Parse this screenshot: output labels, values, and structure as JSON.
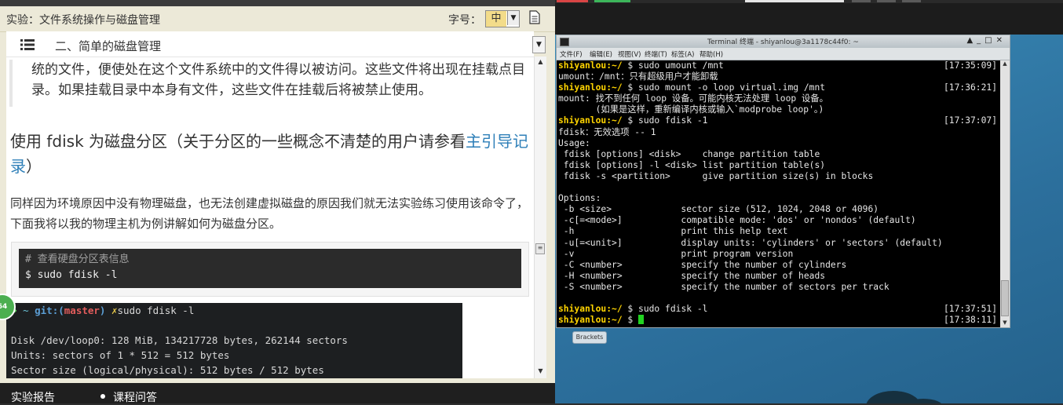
{
  "left_panel": {
    "experiment_title": "实验：文件系统操作与磁盘管理",
    "font_size_label": "字号：",
    "font_size_value": "中",
    "section_title": "二、简单的磁盘管理",
    "quote_text": "统的文件，便使处在这个文件系统中的文件得以被访问。这些文件将出现在挂载点目录。如果挂载目录中本身有文件，这些文件在挂载后将被禁止使用。",
    "heading_text": "使用 fdisk 为磁盘分区（关于分区的一些概念不清楚的用户请参看",
    "heading_link": "主引导记录",
    "heading_end": "）",
    "paragraph": "同样因为环境原因中没有物理磁盘，也无法创建虚拟磁盘的原因我们就无法实验练习使用该命令了，下面我将以我的物理主机为例讲解如何为磁盘分区。",
    "code_comment": "# 查看硬盘分区表信息",
    "code_command": "$ sudo fdisk -l",
    "screenshot": {
      "arrow": "➜",
      "tilde": "~",
      "git": "git:(",
      "branch": "master",
      "git_close": ")",
      "x_mark": "✗",
      "command": "sudo fdisk -l",
      "lines": [
        "Disk /dev/loop0: 128 MiB, 134217728 bytes, 262144 sectors",
        "Units: sectors of 1 * 512 = 512 bytes",
        "Sector size (logical/physical): 512 bytes / 512 bytes"
      ]
    },
    "badge": "64",
    "bottom_tabs": [
      "实验报告",
      "课程问答"
    ]
  },
  "terminal": {
    "title": "Terminal 终端 - shiyanlou@3a1178c44f0: ~",
    "menu": [
      "文件(F)",
      "编辑(E)",
      "视图(V)",
      "终端(T)",
      "标签(A)",
      "帮助(H)"
    ],
    "prompt": "shiyanlou:~/",
    "lines": [
      {
        "prompt": true,
        "text": " $ sudo umount /mnt",
        "time": "[17:35:09]"
      },
      {
        "prompt": false,
        "text": "umount：/mnt：只有超级用户才能卸载",
        "time": ""
      },
      {
        "prompt": true,
        "text": " $ sudo mount -o loop virtual.img /mnt",
        "time": "[17:36:21]"
      },
      {
        "prompt": false,
        "text": "mount: 找不到任何 loop 设备。可能内核无法处理 loop 设备。",
        "time": ""
      },
      {
        "prompt": false,
        "text": "       (如果是这样，重新编译内核或输入`modprobe loop'。)",
        "time": ""
      },
      {
        "prompt": true,
        "text": " $ sudo fdisk -1",
        "time": "[17:37:07]"
      },
      {
        "prompt": false,
        "text": "fdisk：无效选项 -- 1",
        "time": ""
      },
      {
        "prompt": false,
        "text": "Usage:",
        "time": ""
      },
      {
        "prompt": false,
        "text": " fdisk [options] <disk>    change partition table",
        "time": ""
      },
      {
        "prompt": false,
        "text": " fdisk [options] -l <disk> list partition table(s)",
        "time": ""
      },
      {
        "prompt": false,
        "text": " fdisk -s <partition>      give partition size(s) in blocks",
        "time": ""
      },
      {
        "prompt": false,
        "text": "",
        "time": ""
      },
      {
        "prompt": false,
        "text": "Options:",
        "time": ""
      },
      {
        "prompt": false,
        "text": " -b <size>             sector size (512, 1024, 2048 or 4096)",
        "time": ""
      },
      {
        "prompt": false,
        "text": " -c[=<mode>]           compatible mode: 'dos' or 'nondos' (default)",
        "time": ""
      },
      {
        "prompt": false,
        "text": " -h                    print this help text",
        "time": ""
      },
      {
        "prompt": false,
        "text": " -u[=<unit>]           display units: 'cylinders' or 'sectors' (default)",
        "time": ""
      },
      {
        "prompt": false,
        "text": " -v                    print program version",
        "time": ""
      },
      {
        "prompt": false,
        "text": " -C <number>           specify the number of cylinders",
        "time": ""
      },
      {
        "prompt": false,
        "text": " -H <number>           specify the number of heads",
        "time": ""
      },
      {
        "prompt": false,
        "text": " -S <number>           specify the number of sectors per track",
        "time": ""
      },
      {
        "prompt": false,
        "text": "",
        "time": ""
      },
      {
        "prompt": true,
        "text": " $ sudo fdisk -l",
        "time": "[17:37:51]"
      },
      {
        "prompt": true,
        "text": " $ ",
        "time": "[17:38:11]",
        "cursor": true
      }
    ]
  },
  "desktop": {
    "brackets_label": "Brackets"
  },
  "colors": {
    "prompt": "#ffd400",
    "cursor": "#22d422",
    "link": "#2e7fb8",
    "desktop": "#2f7aa6"
  }
}
